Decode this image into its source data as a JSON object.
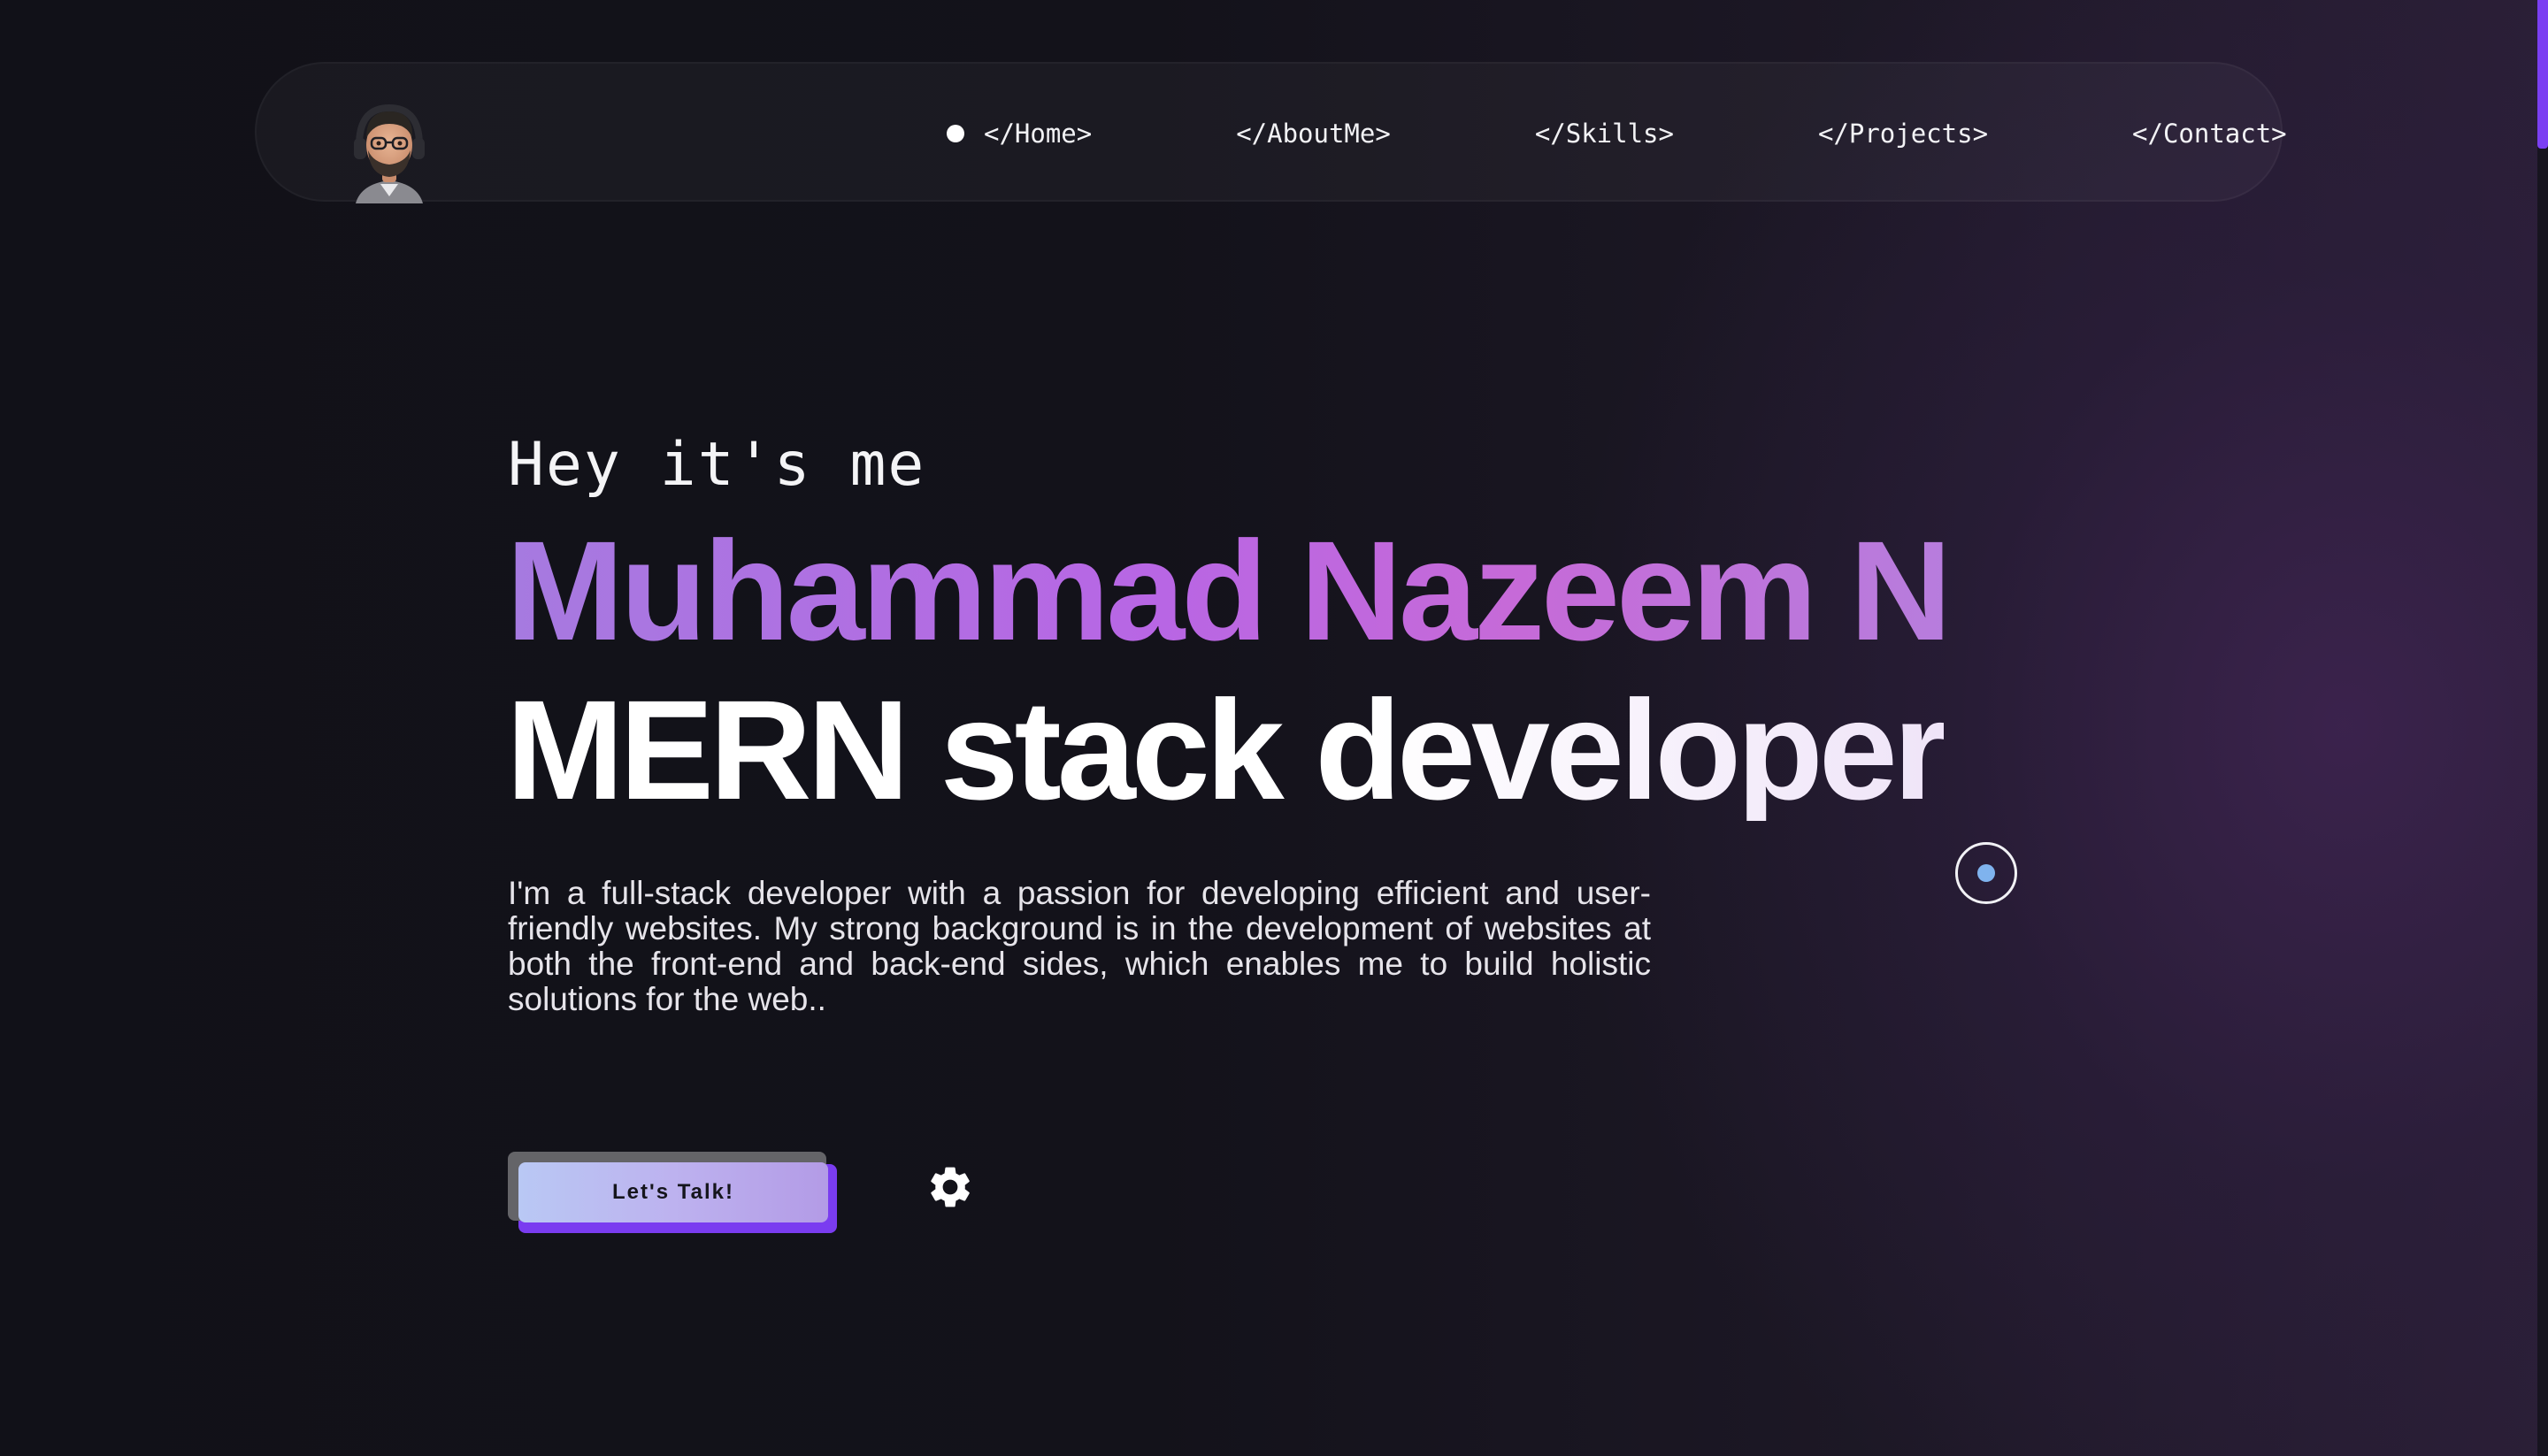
{
  "nav": {
    "avatar_alt": "avatar",
    "links": [
      {
        "label": "</Home>",
        "active": true
      },
      {
        "label": "</AboutMe>",
        "active": false
      },
      {
        "label": "</Skills>",
        "active": false
      },
      {
        "label": "</Projects>",
        "active": false
      },
      {
        "label": "</Contact>",
        "active": false
      }
    ]
  },
  "hero": {
    "greeting": "Hey it's me",
    "name": "Muhammad Nazeem N",
    "role": "MERN stack developer",
    "bio": "I'm a full-stack developer with a passion for developing efficient and user-friendly websites. My strong background is in the development of websites at both the front-end and back-end sides, which enables me to build holistic solutions for the web..",
    "cta_label": "Let's Talk!"
  },
  "icons": {
    "settings": "gear-icon",
    "cursor": "cursor-ring-icon"
  },
  "colors": {
    "accent": "#7a3cf0",
    "name_gradient_start": "#a67ae0",
    "name_gradient_mid": "#c66ad8",
    "cursor_dot": "#7fb3ee"
  }
}
